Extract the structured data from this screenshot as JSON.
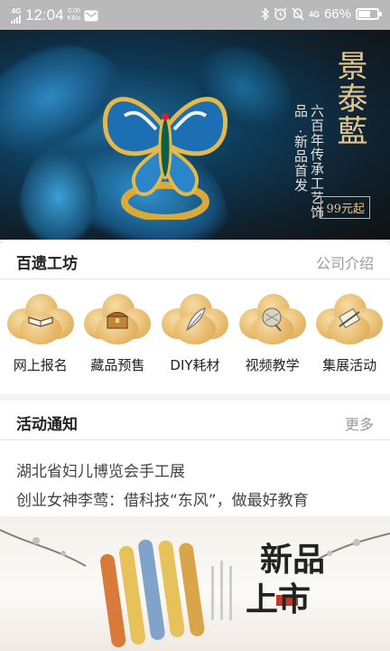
{
  "status_bar": {
    "network_type": "4G",
    "time": "12:04",
    "speed_value": "0.00",
    "speed_unit": "KB/s",
    "signal_4g": "4G",
    "battery_percent": "66%",
    "battery_level": 0.66,
    "icons": [
      "signal-icon",
      "message-icon",
      "bluetooth-icon",
      "alarm-icon",
      "silent-icon",
      "battery-icon"
    ]
  },
  "hero": {
    "title": "景泰藍",
    "subtitle_line1": "六百年传承工艺饰品",
    "subtitle_line2": "·新品首发",
    "price": "99元起"
  },
  "workshop": {
    "title": "百遗工坊",
    "link": "公司介绍",
    "items": [
      {
        "label": "网上报名",
        "icon": "book-icon"
      },
      {
        "label": "藏品预售",
        "icon": "treasure-chest-icon"
      },
      {
        "label": "DIY耗材",
        "icon": "feather-icon"
      },
      {
        "label": "视频教学",
        "icon": "fan-icon"
      },
      {
        "label": "集展活动",
        "icon": "scroll-icon"
      }
    ]
  },
  "notices": {
    "title": "活动通知",
    "link": "更多",
    "items": [
      "湖北省妇儿博览会手工展",
      "创业女神李莺：借科技“东风”，做最好教育"
    ]
  },
  "promo": {
    "title_line1": "新品",
    "title_line2": "上市"
  },
  "colors": {
    "statusbar": "#b9b9b9",
    "accent_gold": "#e3c68c",
    "cloud_gold": "#e6b96a"
  }
}
